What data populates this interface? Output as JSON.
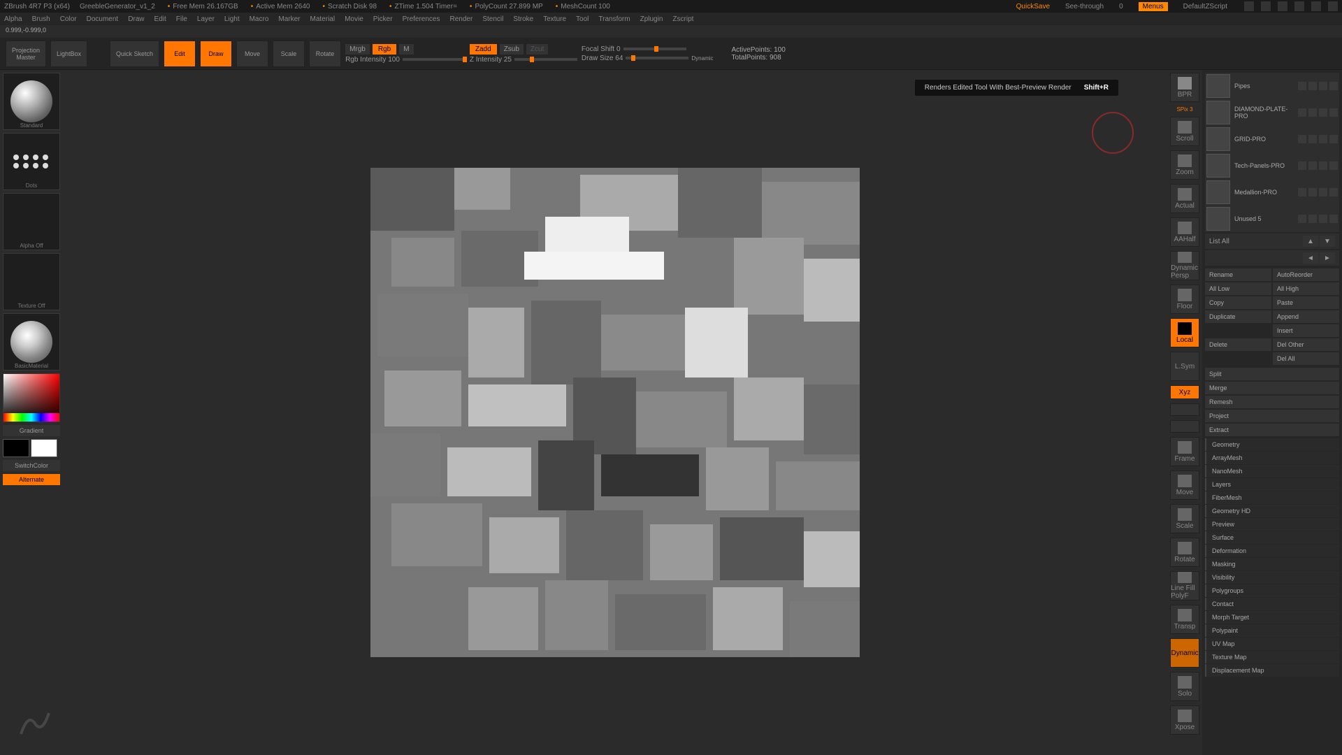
{
  "titlebar": {
    "app": "ZBrush 4R7 P3 (x64)",
    "doc": "GreebleGenerator_v1_2",
    "stats": [
      "Free Mem 26.167GB",
      "Active Mem 2640",
      "Scratch Disk 98",
      "ZTime 1.504 Timer=",
      "PolyCount 27.899 MP",
      "MeshCount 100"
    ],
    "quicksave": "QuickSave",
    "seethrough": "See-through",
    "seethrough_val": "0",
    "menus": "Menus",
    "script": "DefaultZScript"
  },
  "menubar": [
    "Alpha",
    "Brush",
    "Color",
    "Document",
    "Draw",
    "Edit",
    "File",
    "Layer",
    "Light",
    "Macro",
    "Marker",
    "Material",
    "Movie",
    "Picker",
    "Preferences",
    "Render",
    "Stencil",
    "Stroke",
    "Texture",
    "Tool",
    "Transform",
    "Zplugin",
    "Zscript"
  ],
  "coords": "0.999,-0.999,0",
  "shelf": {
    "projection": "Projection\nMaster",
    "lightbox": "LightBox",
    "quicksketch": "Quick\nSketch",
    "edit": "Edit",
    "draw": "Draw",
    "move": "Move",
    "scale": "Scale",
    "rotate": "Rotate",
    "mrgb": "Mrgb",
    "rgb": "Rgb",
    "m": "M",
    "rgb_intensity": "Rgb Intensity 100",
    "zadd": "Zadd",
    "zsub": "Zsub",
    "zcut": "Zcut",
    "z_intensity": "Z Intensity 25",
    "focal": "Focal Shift 0",
    "drawsize": "Draw Size 64",
    "dynamic": "Dynamic",
    "activepts": "ActivePoints: 100",
    "totalpts": "TotalPoints: 908"
  },
  "left": {
    "brush": "Standard",
    "stroke": "Dots",
    "alpha": "Alpha Off",
    "texture": "Texture Off",
    "material": "BasicMaterial",
    "gradient": "Gradient",
    "switchcolor": "SwitchColor",
    "alternate": "Alternate"
  },
  "tooltip": {
    "text": "Renders Edited Tool With Best-Preview Render",
    "shortcut": "Shift+R"
  },
  "dock": [
    "BPR",
    "SPix 3",
    "Scroll",
    "Zoom",
    "Actual",
    "AAHalf",
    "Dynamic\nPersp",
    "Floor",
    "Local",
    "L.Sym",
    "Xyz",
    "",
    "",
    "Frame",
    "Move",
    "Scale",
    "Rotate",
    "Line Fill\nPolyF",
    "Transp",
    "Dynamic",
    "Solo",
    "Xpose"
  ],
  "subtools": [
    {
      "name": "Pipes"
    },
    {
      "name": "DIAMOND-PLATE-PRO"
    },
    {
      "name": "GRID-PRO"
    },
    {
      "name": "Tech-Panels-PRO"
    },
    {
      "name": "Medallion-PRO"
    },
    {
      "name": "Unused 5"
    }
  ],
  "listall": "List All",
  "panel_buttons": [
    [
      "Rename",
      "AutoReorder"
    ],
    [
      "All Low",
      "All High"
    ],
    [
      "Copy",
      "Paste"
    ],
    [
      "Duplicate",
      "Append"
    ],
    [
      "",
      "Insert"
    ],
    [
      "Delete",
      "Del Other"
    ],
    [
      "",
      "Del All"
    ]
  ],
  "single_buttons": [
    "Split",
    "Merge",
    "Remesh",
    "Project",
    "Extract"
  ],
  "sections": [
    "Geometry",
    "ArrayMesh",
    "NanoMesh",
    "Layers",
    "FiberMesh",
    "Geometry HD",
    "Preview",
    "Surface",
    "Deformation",
    "Masking",
    "Visibility",
    "Polygroups",
    "Contact",
    "Morph Target",
    "Polypaint",
    "UV Map",
    "Texture Map",
    "Displacement Map"
  ]
}
